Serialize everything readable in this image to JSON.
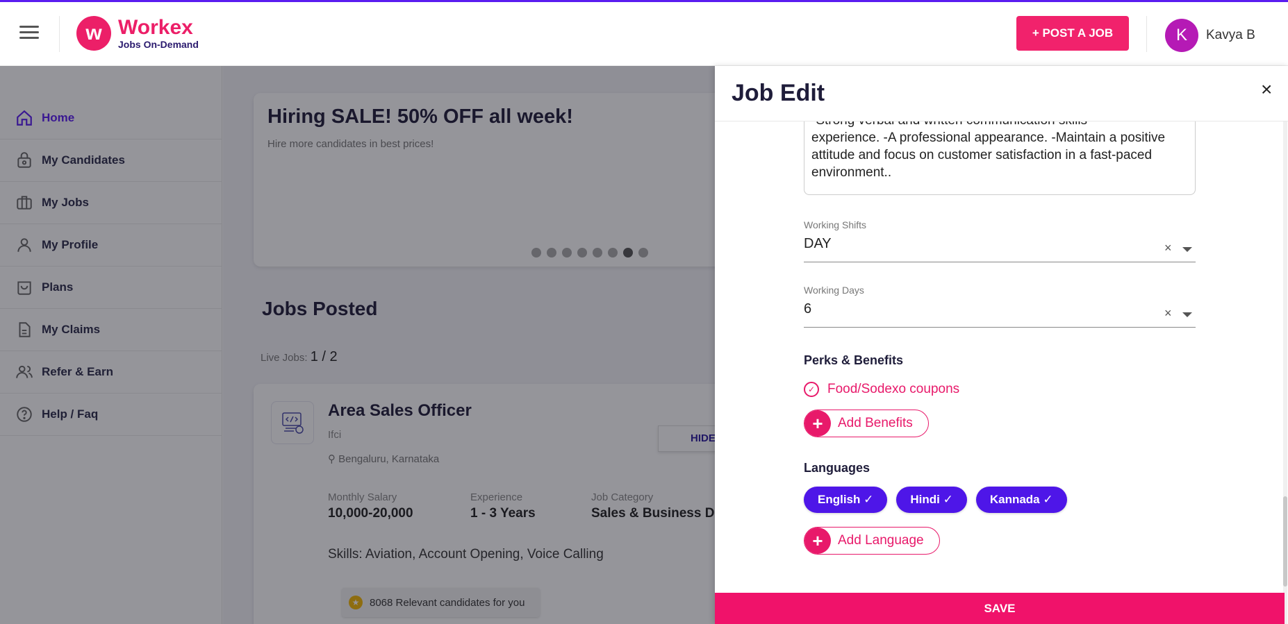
{
  "header": {
    "logo_mark": "w",
    "logo_name": "Workex",
    "logo_tagline": "Jobs On-Demand",
    "post_job_label": "+ POST A JOB",
    "avatar_initial": "K",
    "user_name": "Kavya B"
  },
  "sidebar": {
    "items": [
      {
        "label": "Home",
        "icon": "home-icon",
        "active": true
      },
      {
        "label": "My Candidates",
        "icon": "lock-bag-icon"
      },
      {
        "label": "My Jobs",
        "icon": "briefcase-icon"
      },
      {
        "label": "My Profile",
        "icon": "user-icon"
      },
      {
        "label": "Plans",
        "icon": "bag-icon"
      },
      {
        "label": "My Claims",
        "icon": "document-icon"
      },
      {
        "label": "Refer & Earn",
        "icon": "users-icon"
      },
      {
        "label": "Help / Faq",
        "icon": "help-icon"
      }
    ]
  },
  "banner": {
    "title": "Hiring SALE! 50% OFF all week!",
    "subtitle": "Hire more candidates in best prices!"
  },
  "jobs": {
    "section_title": "Jobs Posted",
    "live_label": "Live Jobs: ",
    "live_value": "1 / 2",
    "card": {
      "title": "Area Sales Officer",
      "company": "Ifci",
      "location": "Bengaluru, Karnataka",
      "hide_label": "HIDE",
      "salary_label": "Monthly Salary",
      "salary_value": "10,000-20,000",
      "experience_label": "Experience",
      "experience_value": "1 - 3 Years",
      "category_label": "Job Category",
      "category_value": "Sales & Business De",
      "skills": "Skills: Aviation, Account Opening, Voice Calling",
      "relevant": "8068 Relevant candidates for you"
    }
  },
  "drawer": {
    "title": "Job Edit",
    "close": "×",
    "description_lines": [
      "-Strong verbal and written communication skills",
      "experience. -A professional appearance. -Maintain a positive",
      "attitude and focus on customer satisfaction in a fast-paced",
      "environment.."
    ],
    "working_shifts": {
      "label": "Working Shifts",
      "value": "DAY"
    },
    "working_days": {
      "label": "Working Days",
      "value": "6"
    },
    "clear_symbol": "×",
    "perks_title": "Perks & Benefits",
    "perks": [
      "Food/Sodexo coupons"
    ],
    "add_benefits_label": "Add Benefits",
    "languages_title": "Languages",
    "languages": [
      "English ✓",
      "Hindi ✓",
      "Kannada ✓"
    ],
    "add_language_label": "Add Language",
    "save_label": "SAVE"
  },
  "colors": {
    "brand_pink": "#f0126a",
    "brand_purple": "#4e16e8"
  }
}
